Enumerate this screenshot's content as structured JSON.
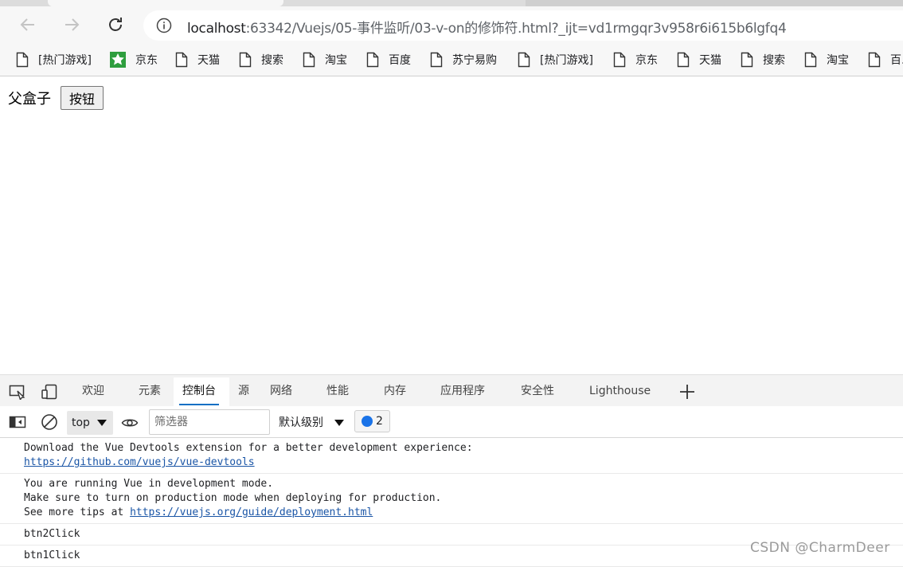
{
  "browser": {
    "url_host": "localhost",
    "url_rest": ":63342/Vuejs/05-事件监听/03-v-on的修饰符.html?_ijt=vd1rmgqr3v958r6i615b6lgfq4",
    "icons": {
      "back": "back-arrow-icon",
      "forward": "forward-arrow-icon",
      "reload": "reload-icon",
      "site_info": "info-icon"
    }
  },
  "bookmarks": [
    {
      "label": "[热门游戏]",
      "icon": "page"
    },
    {
      "label": "京东",
      "icon": "jd"
    },
    {
      "label": "天猫",
      "icon": "page"
    },
    {
      "label": "搜索",
      "icon": "page"
    },
    {
      "label": "淘宝",
      "icon": "page"
    },
    {
      "label": "百度",
      "icon": "page"
    },
    {
      "label": "苏宁易购",
      "icon": "page"
    },
    {
      "label": "[热门游戏]",
      "icon": "page"
    },
    {
      "label": "京东",
      "icon": "page"
    },
    {
      "label": "天猫",
      "icon": "page"
    },
    {
      "label": "搜索",
      "icon": "page"
    },
    {
      "label": "淘宝",
      "icon": "page"
    },
    {
      "label": "百...",
      "icon": "page"
    }
  ],
  "page": {
    "label": "父盒子",
    "button": "按钮"
  },
  "devtools": {
    "tabs": [
      "欢迎",
      "元素",
      "控制台",
      "源",
      "网络",
      "性能",
      "内存",
      "应用程序",
      "安全性",
      "Lighthouse"
    ],
    "active_tab": "控制台",
    "context": "top",
    "filter_placeholder": "筛选器",
    "level": "默认级别",
    "message_count": "2"
  },
  "console": {
    "messages": [
      {
        "lines": [
          "Download the Vue Devtools extension for a better development experience:"
        ],
        "link": "https://github.com/vuejs/vue-devtools",
        "link_prefix": ""
      },
      {
        "lines": [
          "You are running Vue in development mode.",
          "Make sure to turn on production mode when deploying for production."
        ],
        "link": "https://vuejs.org/guide/deployment.html",
        "link_prefix": "See more tips at "
      },
      {
        "lines": [
          "btn2Click"
        ]
      },
      {
        "lines": [
          "btn1Click"
        ]
      }
    ]
  },
  "watermark": "CSDN @CharmDeer",
  "colors": {
    "accent": "#0b6fc4",
    "link": "#1a55a6",
    "jd_green": "#2e9e3e"
  }
}
